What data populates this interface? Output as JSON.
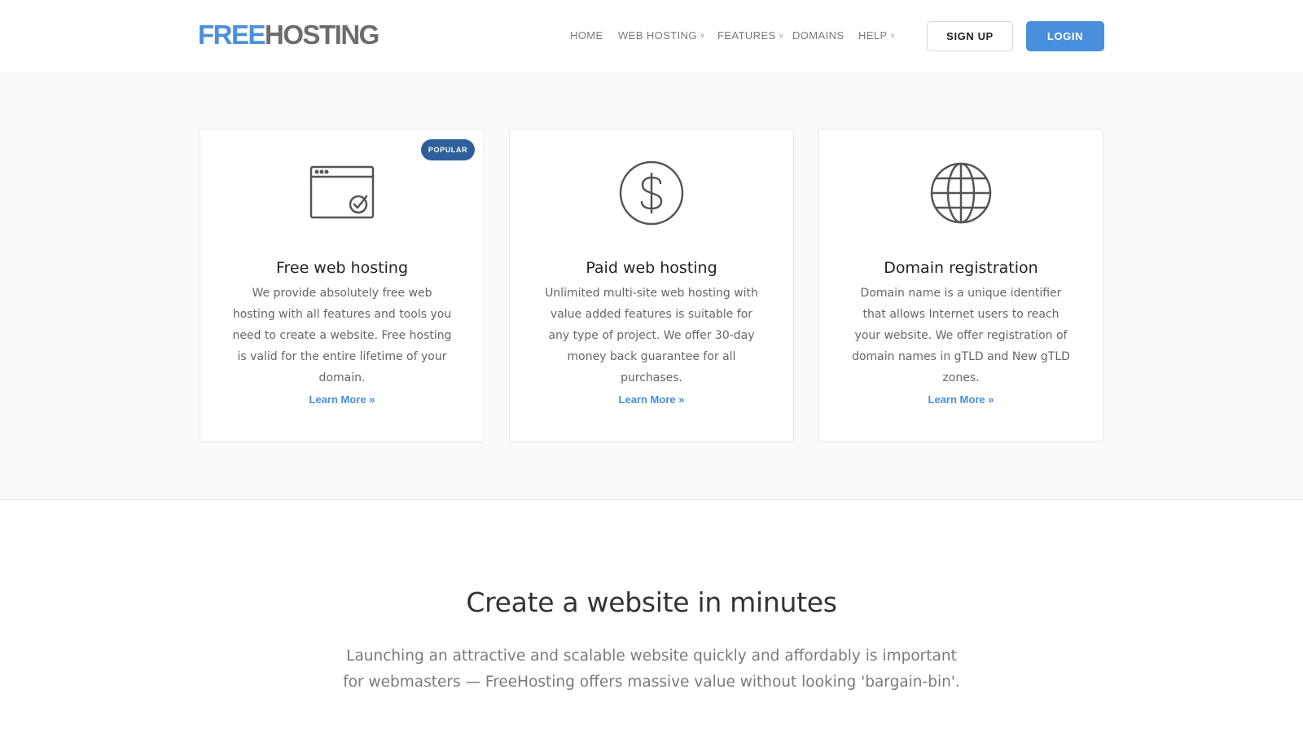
{
  "brand": {
    "part1": "FREE",
    "part2": "HOSTING"
  },
  "nav": {
    "items": [
      {
        "label": "HOME",
        "has_dropdown": false
      },
      {
        "label": "WEB HOSTING",
        "has_dropdown": true
      },
      {
        "label": "FEATURES",
        "has_dropdown": true
      },
      {
        "label": "DOMAINS",
        "has_dropdown": false
      },
      {
        "label": "HELP",
        "has_dropdown": true
      }
    ],
    "dropdown_glyph": "˅"
  },
  "auth": {
    "signup_label": "SIGN UP",
    "login_label": "LOGIN"
  },
  "colors": {
    "brand_blue": "#4a90d9",
    "brand_gray": "#6c6c6c",
    "badge_bg": "#2f5f9a",
    "link_blue": "#4a8fd6",
    "icon_stroke": "#555555"
  },
  "cards": [
    {
      "icon": "browser-check-icon",
      "badge": "POPULAR",
      "title": "Free web hosting",
      "description": "We provide absolutely free web hosting with all features and tools you need to create a website. Free hosting is valid for the entire lifetime of your domain.",
      "link": "Learn More »"
    },
    {
      "icon": "dollar-circle-icon",
      "badge": "",
      "title": "Paid web hosting",
      "description": "Unlimited multi-site web hosting with value added features is suitable for any type of project. We offer 30-day money back guarantee for all purchases.",
      "link": "Learn More »"
    },
    {
      "icon": "globe-icon",
      "badge": "",
      "title": "Domain registration",
      "description": "Domain name is a unique identifier that allows Internet users to reach your website. We offer registration of domain names in gTLD and New gTLD zones.",
      "link": "Learn More »"
    }
  ],
  "hero": {
    "title": "Create a website in minutes",
    "subtitle_line1": "Launching an attractive and scalable website quickly and affordably is important",
    "subtitle_line2": "for webmasters — FreeHosting offers massive value without looking 'bargain-bin'."
  }
}
